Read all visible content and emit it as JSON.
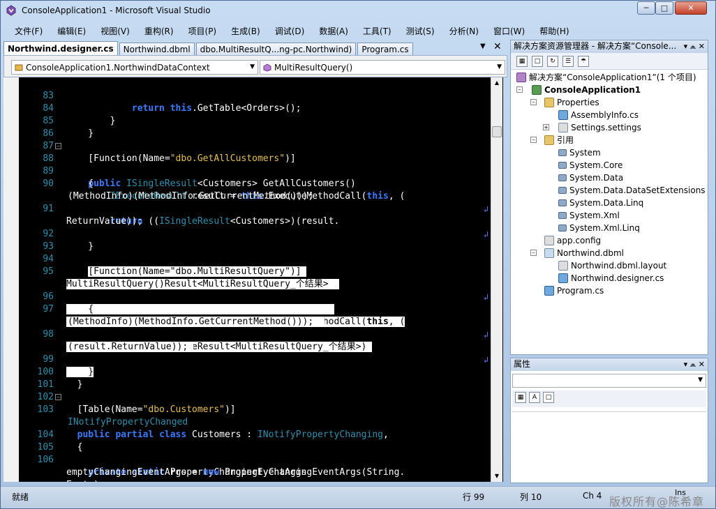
{
  "window": {
    "title": "ConsoleApplication1 - Microsoft Visual Studio",
    "min_icon": "minimize-icon",
    "max_icon": "maximize-icon",
    "close_icon": "close-icon"
  },
  "menu": [
    "文件(F)",
    "编辑(E)",
    "视图(V)",
    "重构(R)",
    "项目(P)",
    "生成(B)",
    "调试(D)",
    "数据(A)",
    "工具(T)",
    "测试(S)",
    "分析(N)",
    "窗口(W)",
    "帮助(H)"
  ],
  "tabs": [
    "Northwind.designer.cs",
    "Northwind.dbml",
    "dbo.MultiResultQ...ng-pc.Northwind)",
    "Program.cs"
  ],
  "nav": {
    "class_combo": "ConsoleApplication1.NorthwindDataContext",
    "member_combo": "MultiResultQuery()"
  },
  "code": {
    "lines": [
      {
        "n": "83",
        "html": "            <span class=\"kw\">return</span> <span class=\"kw\">this</span>.GetTable&lt;<span class=\"ty\">Orders</span>&gt;();"
      },
      {
        "n": "84",
        "html": "        }"
      },
      {
        "n": "85",
        "html": "    }"
      },
      {
        "n": "86",
        "html": ""
      },
      {
        "n": "87",
        "html": "    [Function(Name=<span class=\"str\">\"dbo.GetAllCustomers\"</span>)]"
      },
      {
        "n": "88",
        "html": "    <span class=\"kw\">public</span> <span class=\"ty\">ISingleResult</span>&lt;Customers&gt; GetAllCustomers()"
      },
      {
        "n": "89",
        "html": "    {"
      },
      {
        "n": "90",
        "html": "        <span class=\"ty\">IExecuteResult</span> result = <span class=\"kw\">this</span>.ExecuteMethodCall(<span class=\"kw\">this</span>, ("
      }
    ]
  },
  "solution_explorer": {
    "header": "解决方案资源管理器 - 解决方案“Console...",
    "solution": "解决方案“ConsoleApplication1”(1 个项目)",
    "project": "ConsoleApplication1",
    "items": [
      {
        "label": "Properties",
        "icon": "folder-icon"
      },
      {
        "label": "AssemblyInfo.cs",
        "icon": "cs-file-icon"
      },
      {
        "label": "Settings.settings",
        "icon": "settings-file-icon"
      },
      {
        "label": "引用",
        "icon": "folder-icon"
      },
      {
        "label": "System",
        "icon": "reference-icon"
      },
      {
        "label": "System.Core",
        "icon": "reference-icon"
      },
      {
        "label": "System.Data",
        "icon": "reference-icon"
      },
      {
        "label": "System.Data.DataSetExtensions",
        "icon": "reference-icon"
      },
      {
        "label": "System.Data.Linq",
        "icon": "reference-icon"
      },
      {
        "label": "System.Xml",
        "icon": "reference-icon"
      },
      {
        "label": "System.Xml.Linq",
        "icon": "reference-icon"
      },
      {
        "label": "app.config",
        "icon": "config-file-icon"
      },
      {
        "label": "Northwind.dbml",
        "icon": "dbml-file-icon"
      },
      {
        "label": "Northwind.dbml.layout",
        "icon": "layout-file-icon"
      },
      {
        "label": "Northwind.designer.cs",
        "icon": "cs-file-icon"
      },
      {
        "label": "Program.cs",
        "icon": "cs-file-icon"
      }
    ]
  },
  "properties": {
    "header": "属性"
  },
  "status": {
    "ready": "就绪",
    "line": "行 99",
    "col": "列 10",
    "ch": "Ch 4",
    "ins": "Ins",
    "watermark": "版权所有@陈希章"
  }
}
